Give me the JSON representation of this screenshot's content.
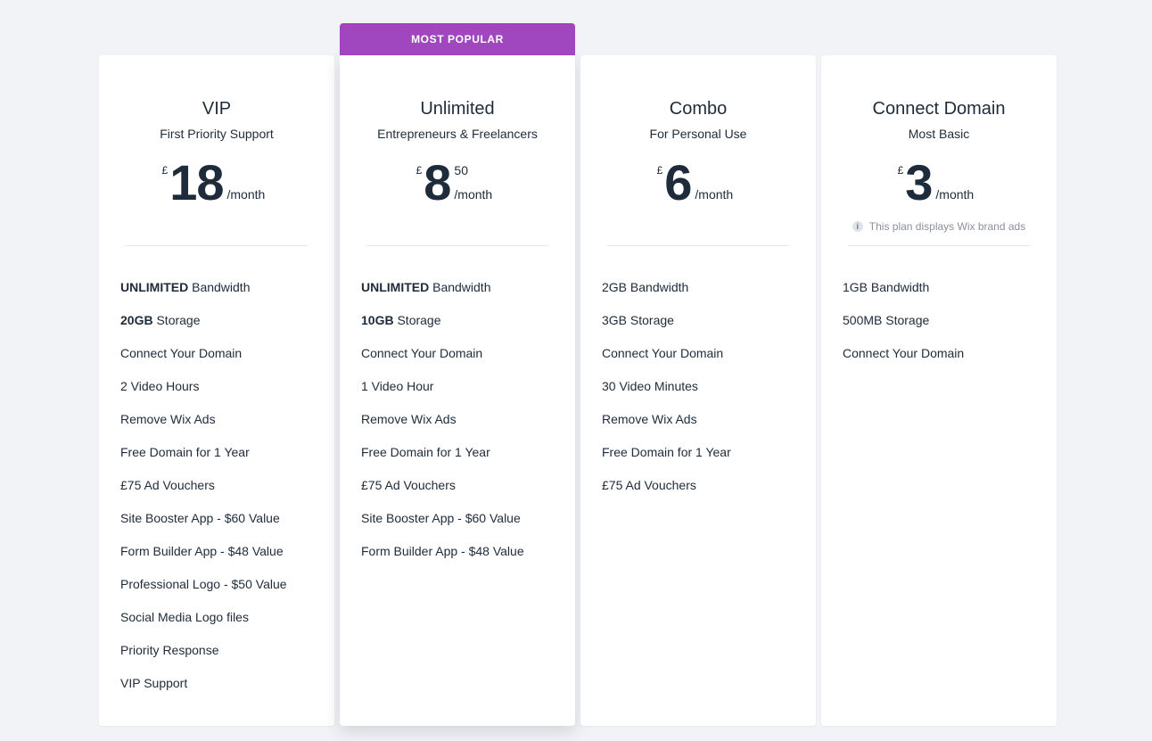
{
  "colors": {
    "accent": "#a046be",
    "text": "#1e2b3a",
    "background": "#f2f3f7"
  },
  "plans": [
    {
      "name": "VIP",
      "tagline": "First Priority Support",
      "currency": "£",
      "amount": "18",
      "cents": "",
      "period": "/month",
      "note": "",
      "features": [
        {
          "bold": "UNLIMITED",
          "text": " Bandwidth"
        },
        {
          "bold": "20GB",
          "text": " Storage"
        },
        {
          "bold": "",
          "text": "Connect Your Domain"
        },
        {
          "bold": "",
          "text": "2 Video Hours"
        },
        {
          "bold": "",
          "text": "Remove Wix Ads"
        },
        {
          "bold": "",
          "text": "Free Domain for 1 Year"
        },
        {
          "bold": "",
          "text": "£75 Ad Vouchers"
        },
        {
          "bold": "",
          "text": "Site Booster App - $60 Value"
        },
        {
          "bold": "",
          "text": "Form Builder App - $48 Value"
        },
        {
          "bold": "",
          "text": "Professional Logo - $50 Value"
        },
        {
          "bold": "",
          "text": "Social Media Logo files"
        },
        {
          "bold": "",
          "text": "Priority Response"
        },
        {
          "bold": "",
          "text": "VIP Support"
        }
      ]
    },
    {
      "name": "Unlimited",
      "tagline": "Entrepreneurs & Freelancers",
      "ribbon": "MOST POPULAR",
      "currency": "£",
      "amount": "8",
      "cents": "50",
      "period": "/month",
      "note": "",
      "features": [
        {
          "bold": "UNLIMITED",
          "text": " Bandwidth"
        },
        {
          "bold": "10GB",
          "text": " Storage"
        },
        {
          "bold": "",
          "text": "Connect Your Domain"
        },
        {
          "bold": "",
          "text": "1 Video Hour"
        },
        {
          "bold": "",
          "text": "Remove Wix Ads"
        },
        {
          "bold": "",
          "text": "Free Domain for 1 Year"
        },
        {
          "bold": "",
          "text": "£75 Ad Vouchers"
        },
        {
          "bold": "",
          "text": "Site Booster App - $60 Value"
        },
        {
          "bold": "",
          "text": "Form Builder App - $48 Value"
        }
      ]
    },
    {
      "name": "Combo",
      "tagline": "For Personal Use",
      "currency": "£",
      "amount": "6",
      "cents": "",
      "period": "/month",
      "note": "",
      "features": [
        {
          "bold": "",
          "text": "2GB Bandwidth"
        },
        {
          "bold": "",
          "text": "3GB Storage"
        },
        {
          "bold": "",
          "text": "Connect Your Domain"
        },
        {
          "bold": "",
          "text": "30 Video Minutes"
        },
        {
          "bold": "",
          "text": "Remove Wix Ads"
        },
        {
          "bold": "",
          "text": "Free Domain for 1 Year"
        },
        {
          "bold": "",
          "text": "£75 Ad Vouchers"
        }
      ]
    },
    {
      "name": "Connect Domain",
      "tagline": "Most Basic",
      "currency": "£",
      "amount": "3",
      "cents": "",
      "period": "/month",
      "note": "This plan displays Wix brand ads",
      "features": [
        {
          "bold": "",
          "text": "1GB Bandwidth"
        },
        {
          "bold": "",
          "text": "500MB Storage"
        },
        {
          "bold": "",
          "text": "Connect Your Domain"
        }
      ]
    }
  ]
}
